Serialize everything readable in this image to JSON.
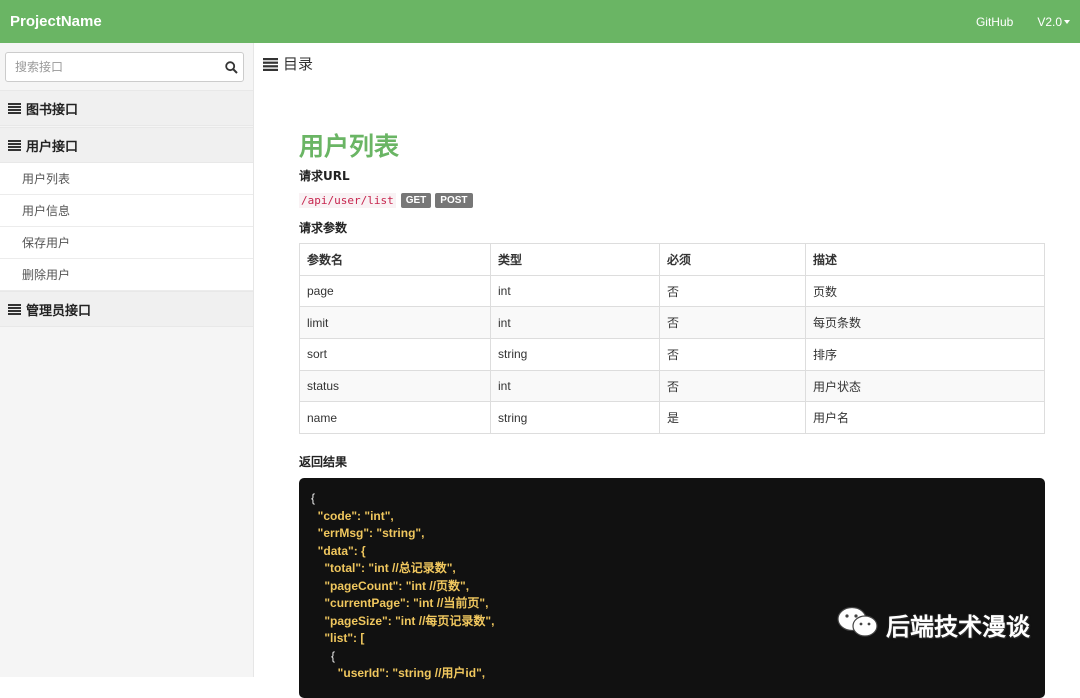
{
  "navbar": {
    "brand": "ProjectName",
    "github": "GitHub",
    "version": "V2.0"
  },
  "sidebar": {
    "search_placeholder": "搜索接口",
    "groups": [
      {
        "label": "图书接口"
      },
      {
        "label": "用户接口",
        "items": [
          "用户列表",
          "用户信息",
          "保存用户",
          "删除用户"
        ]
      },
      {
        "label": "管理员接口"
      }
    ]
  },
  "toc": {
    "label": "目录"
  },
  "doc": {
    "title": "用户列表",
    "url_label": "请求URL",
    "url": "/api/user/list",
    "methods": [
      "GET",
      "POST"
    ],
    "params_label": "请求参数",
    "params_headers": [
      "参数名",
      "类型",
      "必须",
      "描述"
    ],
    "params_rows": [
      [
        "page",
        "int",
        "否",
        "页数"
      ],
      [
        "limit",
        "int",
        "否",
        "每页条数"
      ],
      [
        "sort",
        "string",
        "否",
        "排序"
      ],
      [
        "status",
        "int",
        "否",
        "用户状态"
      ],
      [
        "name",
        "string",
        "是",
        "用户名"
      ]
    ],
    "result_label": "返回结果",
    "result_lines": [
      "{",
      "  \"code\": \"int\",",
      "  \"errMsg\": \"string\",",
      "  \"data\": {",
      "    \"total\": \"int //总记录数\",",
      "    \"pageCount\": \"int //页数\",",
      "    \"currentPage\": \"int //当前页\",",
      "    \"pageSize\": \"int //每页记录数\",",
      "    \"list\": [",
      "      {",
      "        \"userId\": \"string //用户id\","
    ]
  },
  "watermark": {
    "text": "后端技术漫谈"
  }
}
